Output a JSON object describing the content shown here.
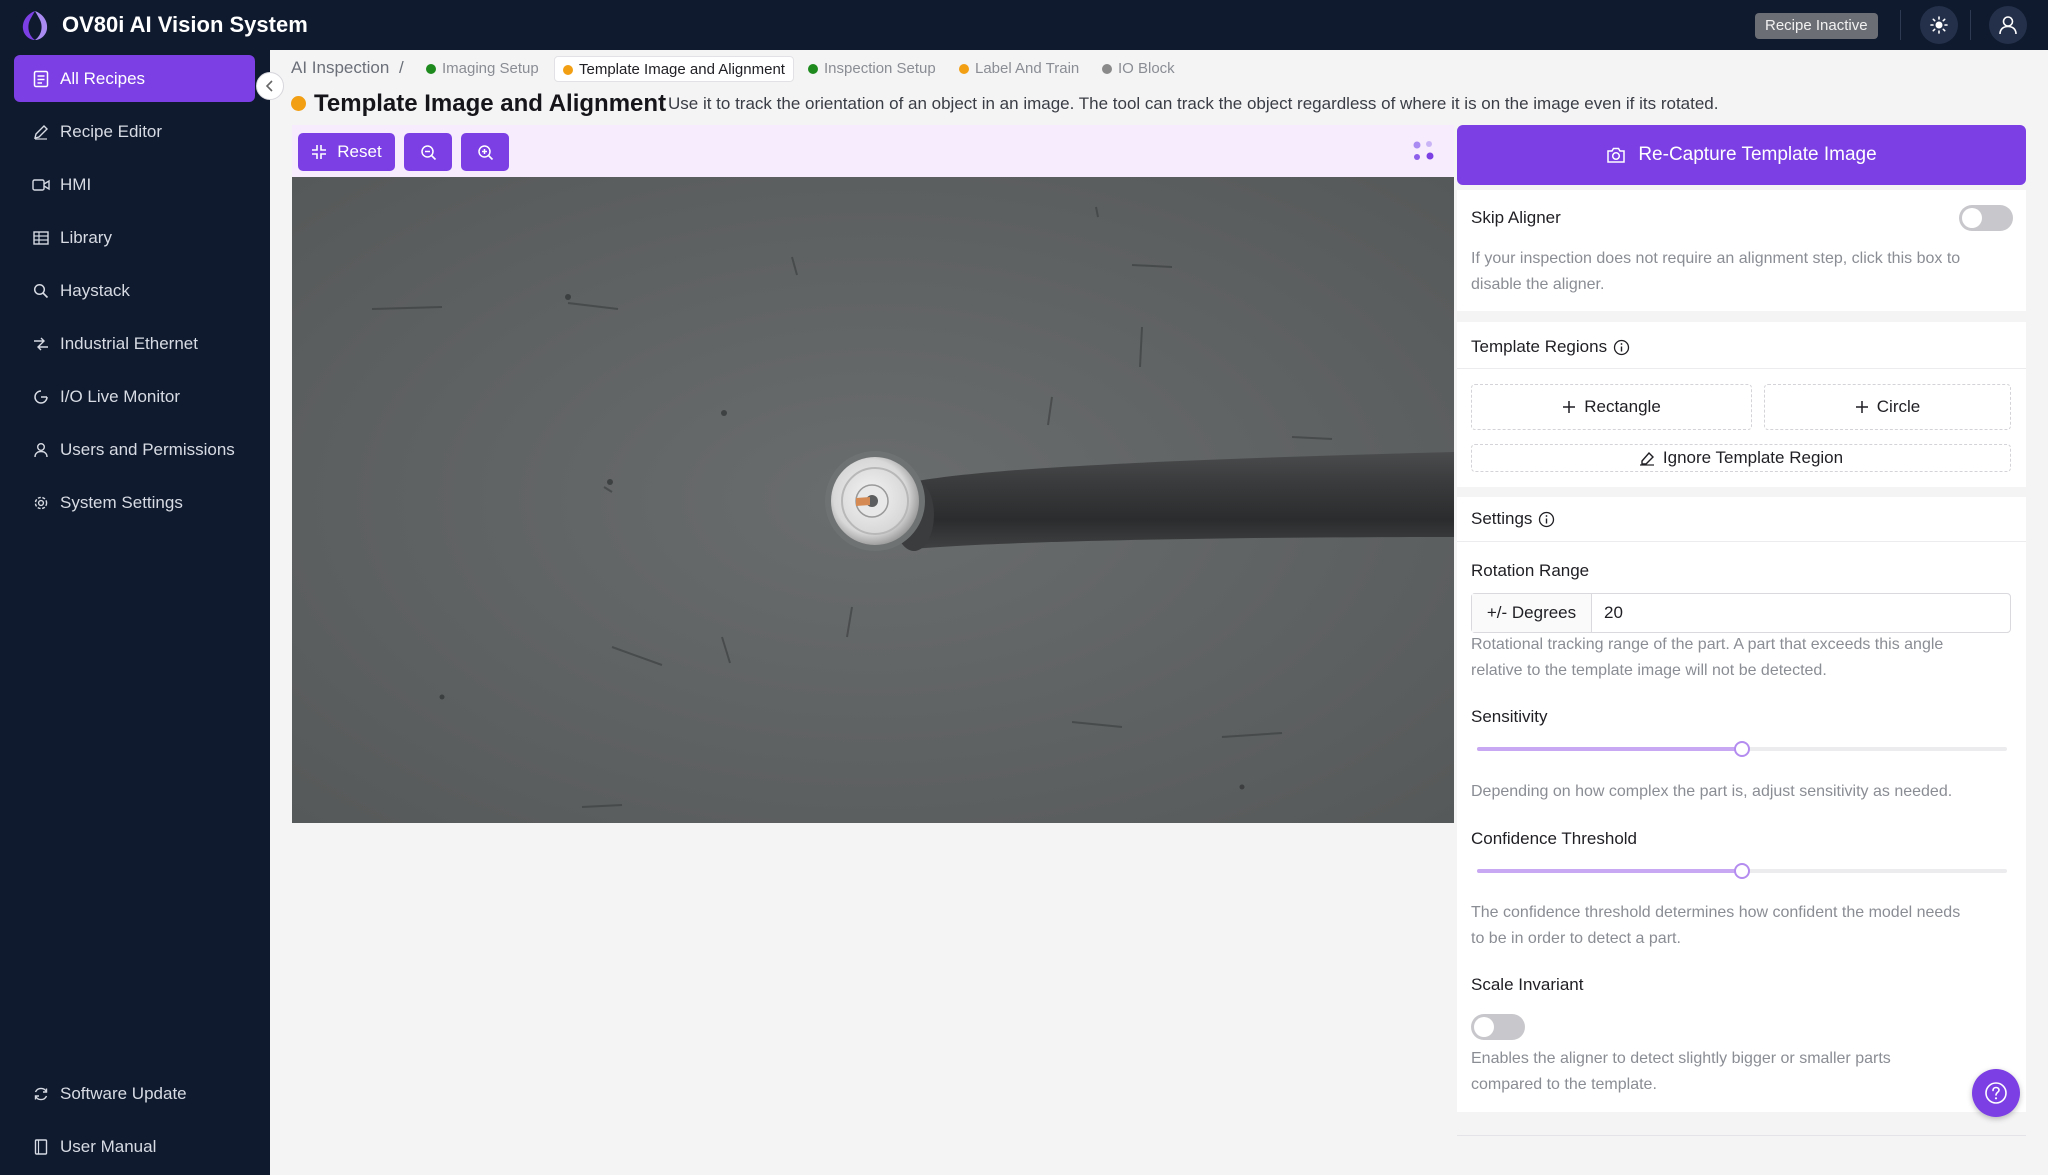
{
  "app": {
    "title": "OV80i AI Vision System",
    "status_badge": "Recipe Inactive"
  },
  "sidebar": {
    "items": [
      {
        "label": "All Recipes",
        "icon": "document-list-icon",
        "active": true
      },
      {
        "label": "Recipe Editor",
        "icon": "pencil-icon"
      },
      {
        "label": "HMI",
        "icon": "video-icon"
      },
      {
        "label": "Library",
        "icon": "table-icon"
      },
      {
        "label": "Haystack",
        "icon": "search-icon"
      },
      {
        "label": "Industrial Ethernet",
        "icon": "network-icon"
      },
      {
        "label": "I/O Live Monitor",
        "icon": "monitor-icon"
      },
      {
        "label": "Users and Permissions",
        "icon": "user-icon"
      },
      {
        "label": "System Settings",
        "icon": "gear-icon"
      }
    ],
    "footer": [
      {
        "label": "Software Update",
        "icon": "refresh-icon"
      },
      {
        "label": "User Manual",
        "icon": "book-icon"
      }
    ]
  },
  "breadcrumb": {
    "root": "AI Inspection",
    "separator": "/",
    "tabs": [
      {
        "label": "Imaging Setup",
        "status_color": "#1e8a1e"
      },
      {
        "label": "Template Image and Alignment",
        "status_color": "#f29f14",
        "active": true
      },
      {
        "label": "Inspection Setup",
        "status_color": "#1e8a1e"
      },
      {
        "label": "Label And Train",
        "status_color": "#f29f14"
      },
      {
        "label": "IO Block",
        "status_color": "#8a8a8a"
      }
    ]
  },
  "heading": {
    "title": "Template Image and Alignment",
    "description": "Use it to track the orientation of an object in an image. The tool can track the object regardless of where it is on the image even if its rotated."
  },
  "toolbar": {
    "reset_label": "Reset",
    "zoom_out_icon": "zoom-out-icon",
    "zoom_in_icon": "zoom-in-icon"
  },
  "panel": {
    "recapture_label": "Re-Capture Template Image",
    "skip_aligner": {
      "label": "Skip Aligner",
      "enabled": false,
      "help": [
        "If your inspection does not require an alignment step, click this box to",
        "disable the aligner."
      ]
    },
    "template_regions": {
      "label": "Template Regions",
      "rectangle_label": "Rectangle",
      "circle_label": "Circle",
      "ignore_label": "Ignore Template Region"
    },
    "settings": {
      "label": "Settings",
      "rotation_label": "Rotation Range",
      "rotation_unit": "+/- Degrees",
      "rotation_value": "20",
      "rotation_help": [
        "Rotational tracking range of the part. A part that exceeds this angle",
        "relative to the template image will not be detected."
      ],
      "sensitivity_label": "Sensitivity",
      "sensitivity_value": 0.5,
      "sensitivity_help": "Depending on how complex the part is, adjust sensitivity as needed.",
      "confidence_label": "Confidence Threshold",
      "confidence_value": 0.5,
      "confidence_help": [
        "The confidence threshold determines how confident the model needs",
        "to be in order to detect a part."
      ],
      "scale_label": "Scale Invariant",
      "scale_enabled": false,
      "scale_help": [
        "Enables the aligner to detect slightly bigger or smaller parts",
        "compared to the template."
      ]
    }
  },
  "colors": {
    "accent": "#7b3fe4",
    "sidebar_bg": "#0f1a2e"
  }
}
